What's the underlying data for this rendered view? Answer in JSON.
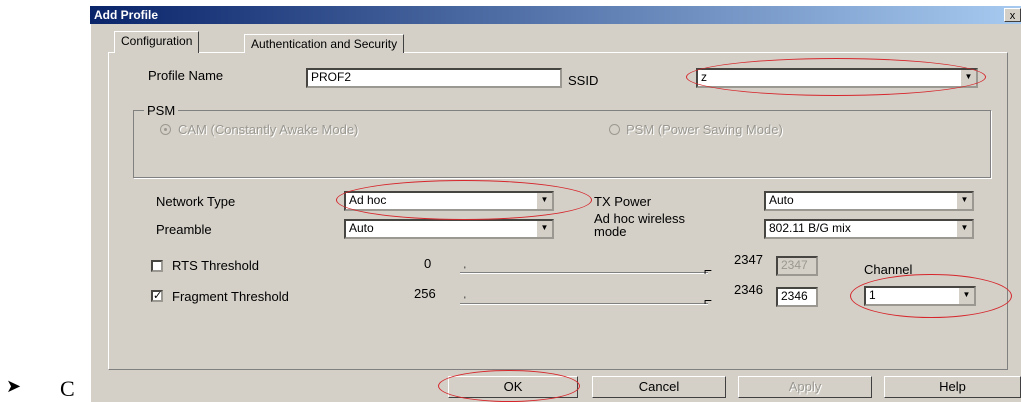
{
  "dialog": {
    "title": "Add Profile",
    "close_glyph": "x"
  },
  "tabs": [
    {
      "label": "Configuration"
    },
    {
      "label": "Authentication and Security"
    }
  ],
  "profile": {
    "name_label": "Profile Name",
    "name_value": "PROF2",
    "ssid_label": "SSID",
    "ssid_value": "z"
  },
  "psm": {
    "group_label": "PSM",
    "cam_label": "CAM (Constantly Awake Mode)",
    "psm_label": "PSM (Power Saving Mode)",
    "selected": "CAM"
  },
  "network": {
    "type_label": "Network Type",
    "type_value": "Ad hoc",
    "preamble_label": "Preamble",
    "preamble_value": "Auto",
    "tx_label": "TX Power",
    "tx_value": "Auto",
    "adhoc_label_1": "Ad hoc wireless",
    "adhoc_label_2": "mode",
    "adhoc_value": "802.11 B/G mix"
  },
  "rts": {
    "label": "RTS Threshold",
    "checked": false,
    "min": "0",
    "max": "2347",
    "value": "2347"
  },
  "fragment": {
    "label": "Fragment Threshold",
    "checked": true,
    "min": "256",
    "max": "2346",
    "value": "2346"
  },
  "channel": {
    "label": "Channel",
    "value": "1"
  },
  "buttons": {
    "ok": "OK",
    "cancel": "Cancel",
    "apply": "Apply",
    "help": "Help"
  },
  "page_bullet": {
    "glyph": "➤",
    "text": "C"
  },
  "annotation_color": "#d6262b"
}
